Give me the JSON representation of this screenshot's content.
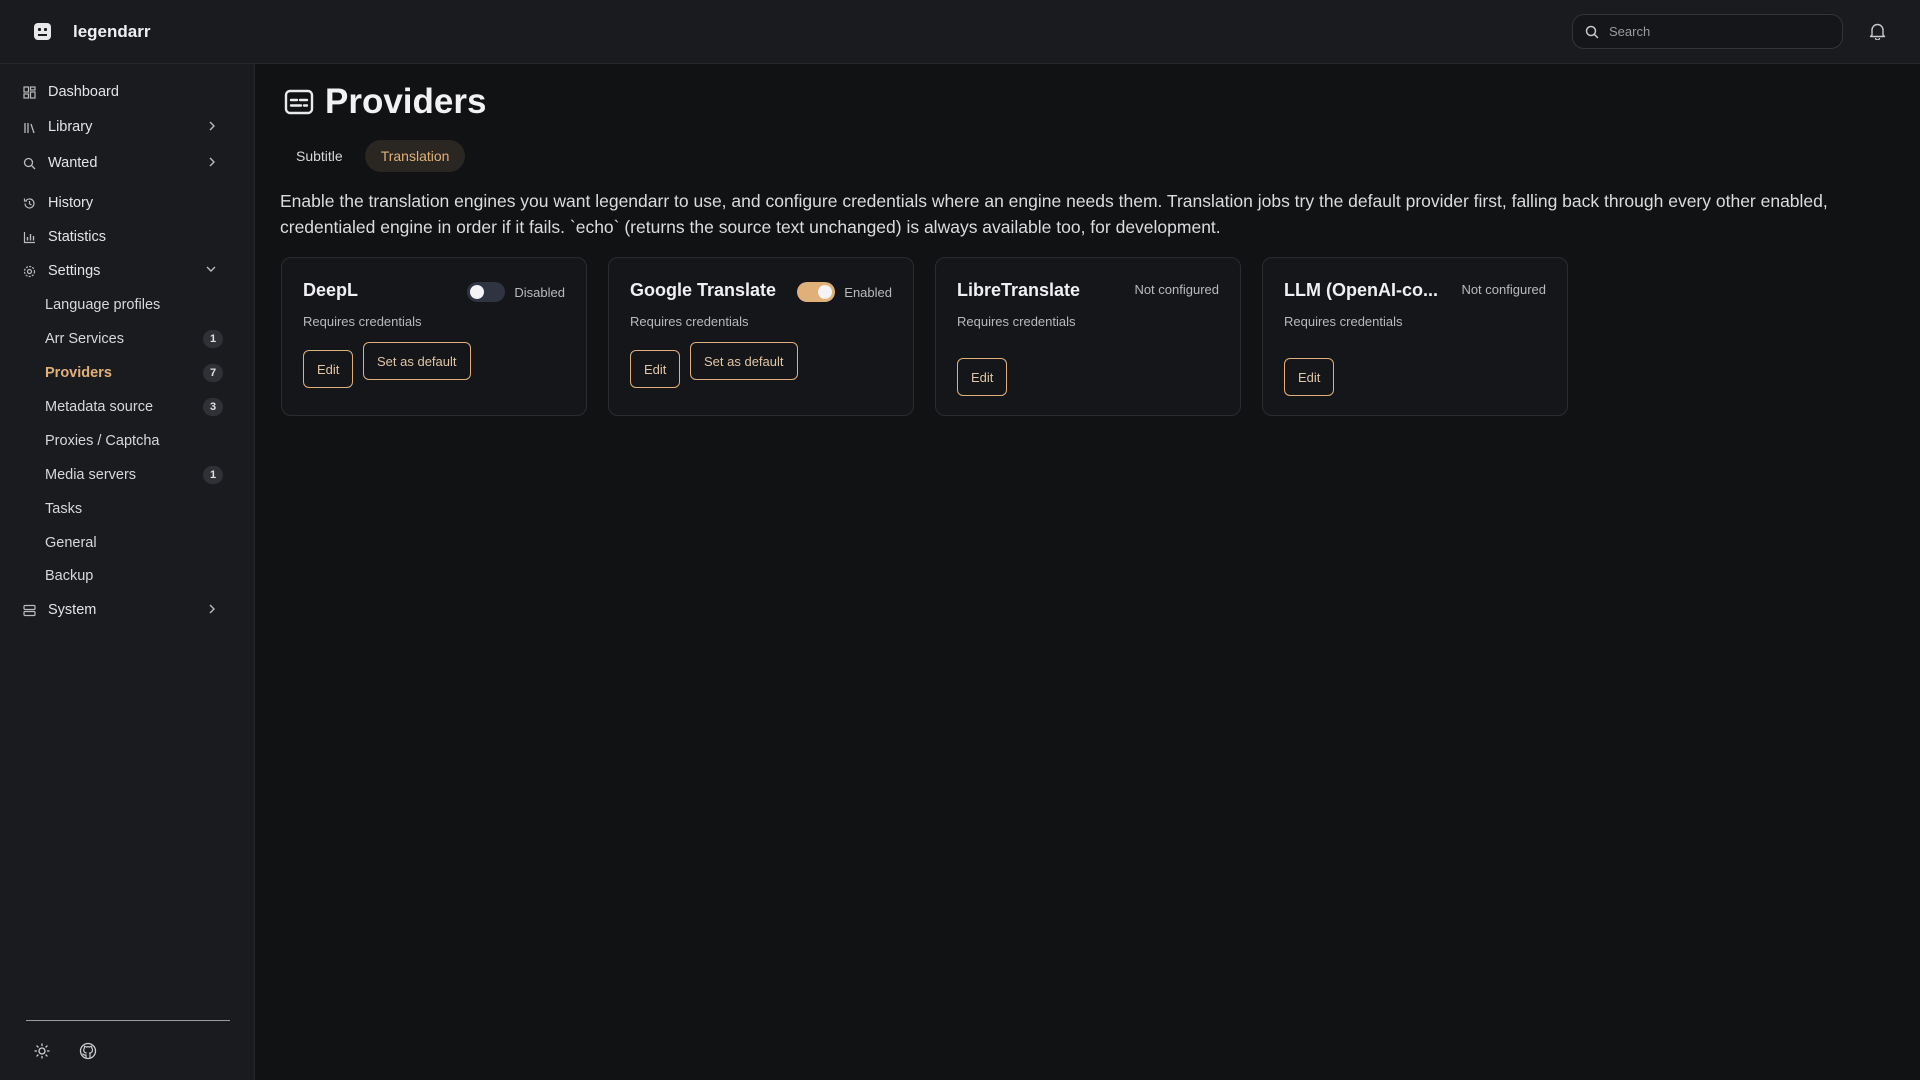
{
  "app": {
    "name": "legendarr"
  },
  "search": {
    "placeholder": "Search"
  },
  "sidebar": {
    "items": [
      {
        "label": "Dashboard",
        "icon": "dashboard-icon"
      },
      {
        "label": "Library",
        "icon": "library-icon"
      },
      {
        "label": "Wanted",
        "icon": "search-icon"
      },
      {
        "label": "History",
        "icon": "history-icon"
      },
      {
        "label": "Statistics",
        "icon": "bar-chart-icon"
      },
      {
        "label": "Settings",
        "icon": "gear-icon"
      },
      {
        "label": "System",
        "icon": "server-icon"
      }
    ],
    "settings_sub": [
      {
        "label": "Language profiles"
      },
      {
        "label": "Arr Services",
        "badge": "1"
      },
      {
        "label": "Providers",
        "badge": "7"
      },
      {
        "label": "Metadata source",
        "badge": "3"
      },
      {
        "label": "Proxies / Captcha"
      },
      {
        "label": "Media servers",
        "badge": "1"
      },
      {
        "label": "Tasks"
      },
      {
        "label": "General"
      },
      {
        "label": "Backup"
      }
    ]
  },
  "page": {
    "title": "Providers",
    "tabs": [
      {
        "label": "Subtitle",
        "active": false
      },
      {
        "label": "Translation",
        "active": true
      }
    ],
    "description": "Enable the translation engines you want legendarr to use, and configure credentials where an engine needs them. Translation jobs try the default provider first, falling back through every other enabled, credentialed engine in order if it fails. `echo` (returns the source text unchanged) is always available too, for development."
  },
  "cards": [
    {
      "name": "DeepL",
      "status": "Disabled",
      "enabled": false,
      "subtitle": "Requires credentials",
      "edit": "Edit",
      "default": "Set as default"
    },
    {
      "name": "Google Translate",
      "status": "Enabled",
      "enabled": true,
      "subtitle": "Requires credentials",
      "edit": "Edit",
      "default": "Set as default"
    },
    {
      "name": "LibreTranslate",
      "status": "Not configured",
      "subtitle": "Requires credentials",
      "edit": "Edit"
    },
    {
      "name": "LLM (OpenAI-co...",
      "status": "Not configured",
      "subtitle": "Requires credentials",
      "edit": "Edit"
    }
  ],
  "colors": {
    "accent": "#e0b07a",
    "background": "#111214",
    "panel": "#1a1b1e"
  }
}
